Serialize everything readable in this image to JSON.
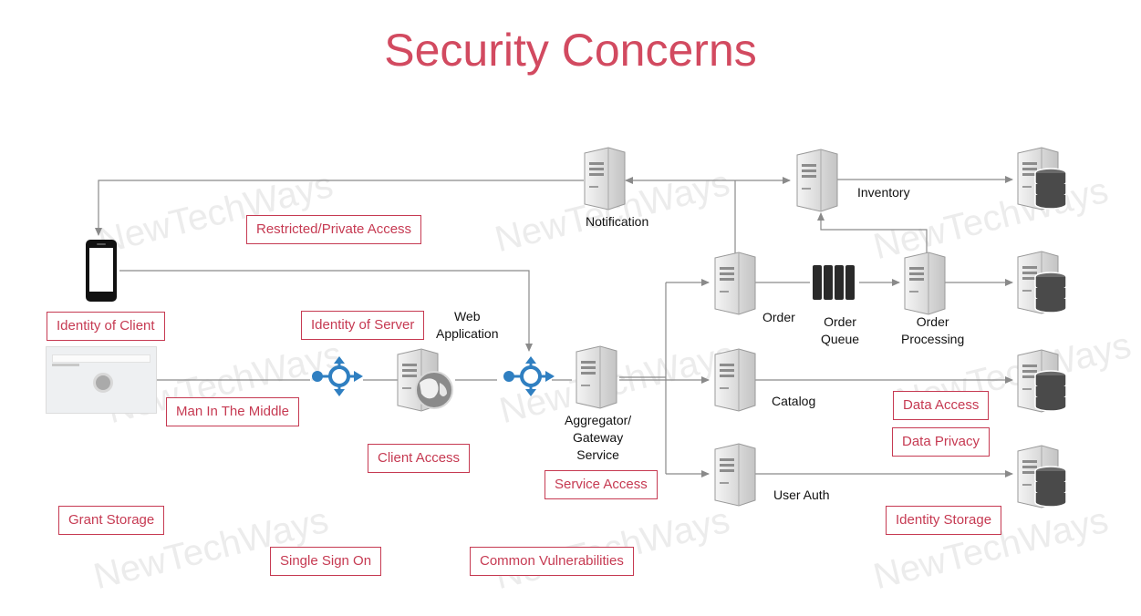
{
  "title": "Security Concerns",
  "watermark": "NewTechWays",
  "colors": {
    "accent": "#c63a52",
    "title": "#d24a60",
    "proxy": "#2f7fc1",
    "server": "#c8c8c8"
  },
  "nodes": {
    "notification": "Notification",
    "inventory": "Inventory",
    "web_app": "Web\nApplication",
    "order": "Order",
    "order_queue": "Order\nQueue",
    "order_processing": "Order\nProcessing",
    "catalog": "Catalog",
    "aggregator": "Aggregator/\nGateway\nService",
    "user_auth": "User Auth"
  },
  "tags": {
    "restricted_access": "Restricted/Private Access",
    "identity_client": "Identity of Client",
    "identity_server": "Identity of Server",
    "mitm": "Man In The Middle",
    "client_access": "Client Access",
    "service_access": "Service Access",
    "data_access": "Data Access",
    "data_privacy": "Data Privacy",
    "identity_storage": "Identity Storage",
    "grant_storage": "Grant Storage",
    "sso": "Single Sign On",
    "vulnerabilities": "Common Vulnerabilities"
  },
  "icons": [
    "mobile-phone-icon",
    "browser-window-icon",
    "proxy-router-icon",
    "web-server-globe-icon",
    "server-icon",
    "database-icon",
    "message-queue-icon"
  ]
}
